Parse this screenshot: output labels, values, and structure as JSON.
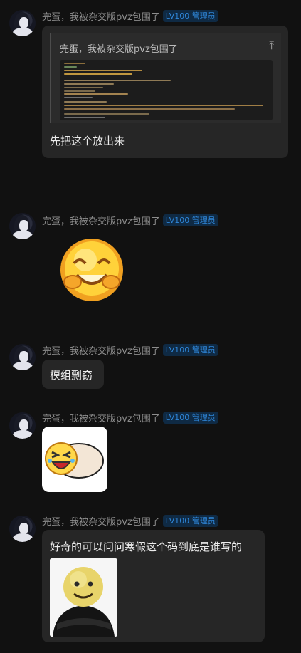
{
  "messages": [
    {
      "nickname": "完蛋，我被杂交版pvz包围了",
      "badge": "LV100 管理员",
      "quote": {
        "name": "完蛋，我被杂交版pvz包围了"
      },
      "text": "先把这个放出来"
    },
    {
      "nickname": "完蛋，我被杂交版pvz包围了",
      "badge": "LV100 管理员",
      "sticker": "grinning-face-sticker"
    },
    {
      "nickname": "完蛋，我被杂交版pvz包围了",
      "badge": "LV100 管理员",
      "text": "模组剽窃"
    },
    {
      "nickname": "完蛋，我被杂交版pvz包围了",
      "badge": "LV100 管理员",
      "sticker": "laughing-dumpling-sticker"
    },
    {
      "nickname": "完蛋，我被杂交版pvz包围了",
      "badge": "LV100 管理员",
      "text": "好奇的可以问问寒假这个码到底是谁写的",
      "image": "arms-crossed-emoji-photo"
    }
  ],
  "colors": {
    "background": "#111111",
    "bubble": "#262626",
    "badge_text": "#2f86d8",
    "badge_bg": "#0f2a44"
  }
}
